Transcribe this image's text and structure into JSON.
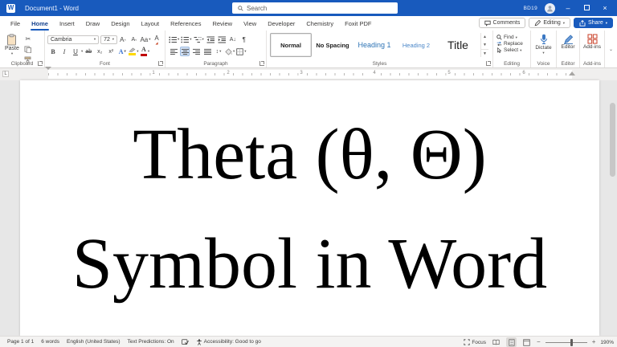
{
  "titlebar": {
    "app_initial": "W",
    "title": "Document1 - Word",
    "search_placeholder": "Search",
    "user_badge": "BD19"
  },
  "tabs": {
    "items": [
      "File",
      "Home",
      "Insert",
      "Draw",
      "Design",
      "Layout",
      "References",
      "Review",
      "View",
      "Developer",
      "Chemistry",
      "Foxit PDF"
    ],
    "active": "Home"
  },
  "actions": {
    "comments": "Comments",
    "editing": "Editing",
    "share": "Share"
  },
  "ribbon": {
    "clipboard": {
      "label": "Clipboard",
      "paste": "Paste"
    },
    "font": {
      "label": "Font",
      "name": "Cambria",
      "size": "72",
      "bold": "B",
      "italic": "I",
      "underline": "U",
      "strike": "ab",
      "subscript": "x₂",
      "superscript": "x²",
      "grow": "A",
      "shrink": "A",
      "case": "Aa",
      "clear": "A",
      "effects": "A",
      "color": "A"
    },
    "paragraph": {
      "label": "Paragraph",
      "sort": "A↓",
      "pilcrow": "¶",
      "spacing": "↕"
    },
    "styles": {
      "label": "Styles",
      "items": [
        "Normal",
        "No Spacing",
        "Heading 1",
        "Heading 2",
        "Title"
      ],
      "selected": "Normal"
    },
    "editing": {
      "label": "Editing",
      "find": "Find",
      "replace": "Replace",
      "select": "Select"
    },
    "voice": {
      "label": "Voice",
      "dictate": "Dictate"
    },
    "editor": {
      "label": "Editor",
      "button": "Editor"
    },
    "addins": {
      "label": "Add-ins",
      "button": "Add-ins"
    }
  },
  "icons": {
    "caret_down": "▾",
    "scissors": "✂",
    "minimize": "–",
    "close": "×"
  },
  "ruler": {
    "numbers": [
      "1",
      "2",
      "3",
      "4",
      "5",
      "6"
    ],
    "tab_selector": "L"
  },
  "document": {
    "line1": "Theta (θ, Θ)",
    "line2": "Symbol in Word"
  },
  "statusbar": {
    "page": "Page 1 of 1",
    "words": "6 words",
    "language": "English (United States)",
    "predictions": "Text Predictions: On",
    "accessibility": "Accessibility: Good to go",
    "focus": "Focus",
    "zoom_minus": "−",
    "zoom_plus": "+",
    "zoom_level": "190%"
  },
  "colors": {
    "titlebar_blue": "#185abd",
    "heading_blue": "#2e74b5",
    "addins_red": "#cd4f38"
  }
}
